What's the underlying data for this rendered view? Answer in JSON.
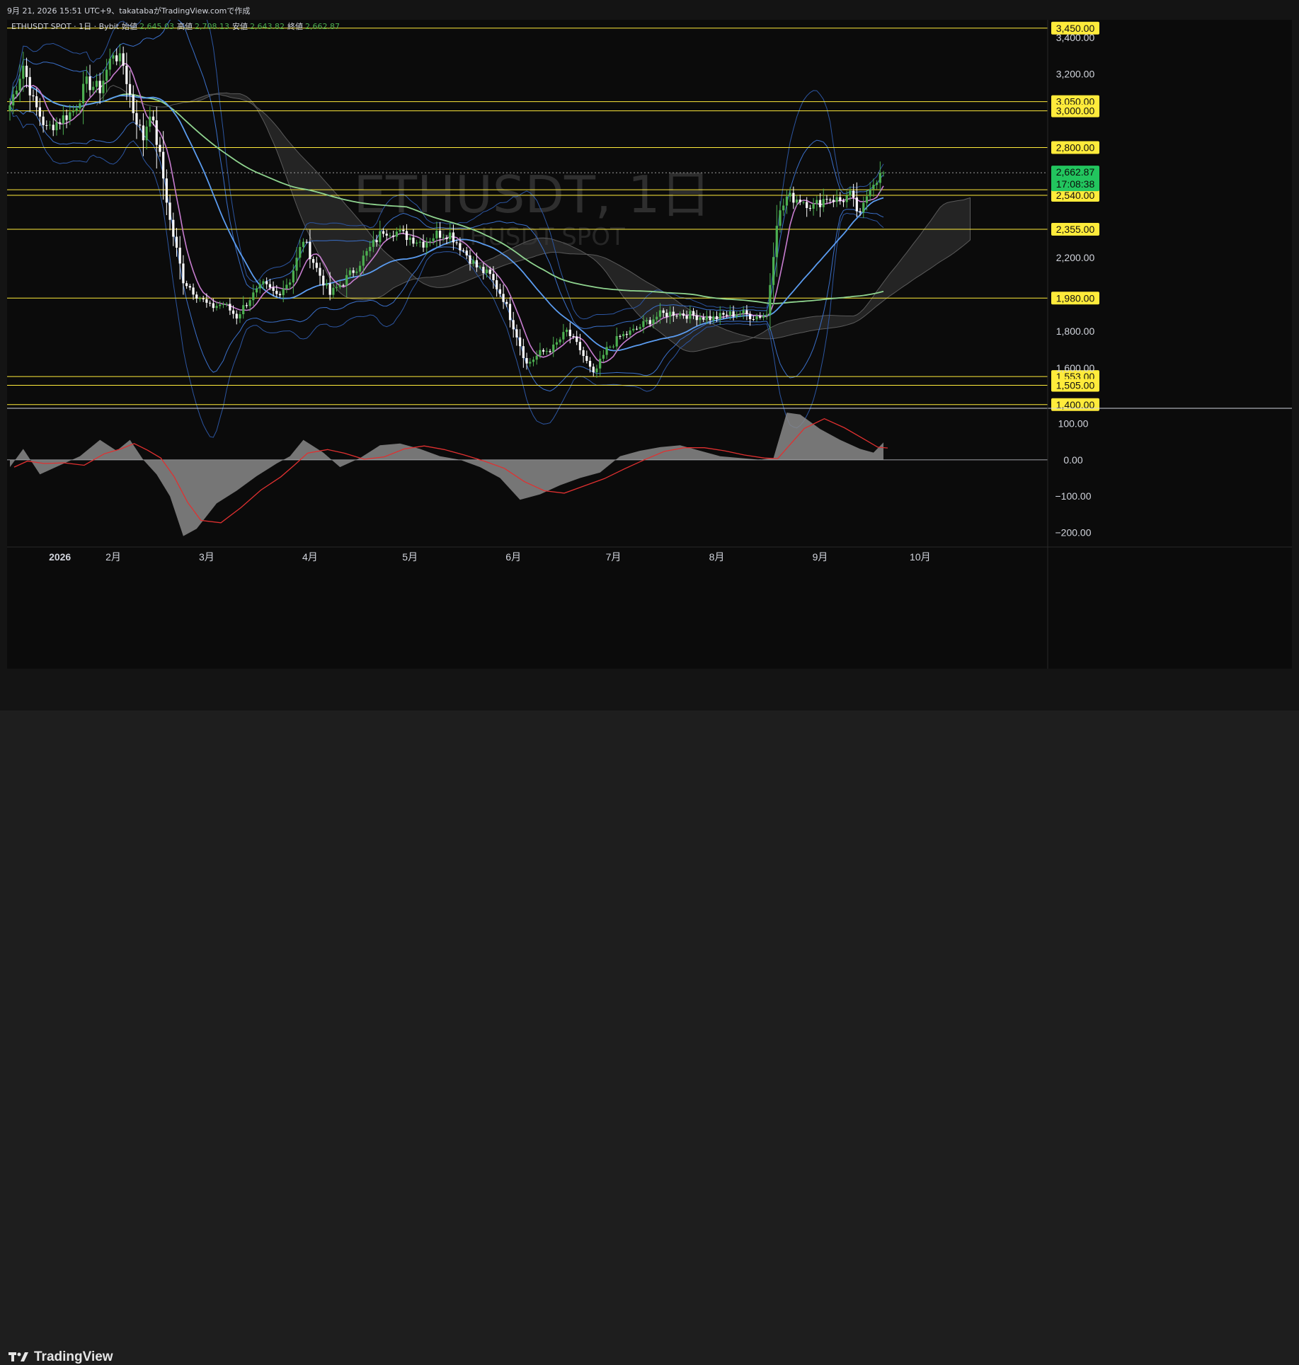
{
  "header": {
    "capture_info": "9月 21, 2026 15:51 UTC+9、takatabaがTradingView.comで作成"
  },
  "legend": {
    "symbol": "ETHUSDT SPOT · 1日 · Bybit",
    "open_label": "始値",
    "open_value": "2,645.03",
    "high_label": "高値",
    "high_value": "2,708.13",
    "low_label": "安値",
    "low_value": "2,643.82",
    "close_label": "終値",
    "close_value": "2,662.87"
  },
  "watermark": {
    "line1": "ETHUSDT, 1日",
    "line2": "ETHUSDT SPOT"
  },
  "footer": {
    "brand": "TradingView"
  },
  "colors": {
    "background": "#0b0b0b",
    "up_candle": "#4caf50",
    "down_candle": "#ffffff",
    "horizontal_line": "#ffeb3b",
    "current_price_bg": "#22c55e",
    "ma_fast": "#c77dcf",
    "ma_mid": "#5b9cf0",
    "ma_slow": "#8fd48f",
    "bollinger": "#3a6fc9",
    "cloud": "#3a3a3a",
    "oscillator_fill": "#8a8a8a",
    "signal_line": "#e03030"
  },
  "chart_data": {
    "type": "candlestick",
    "timeframe": "1日",
    "exchange": "Bybit",
    "symbol": "ETHUSDT",
    "ylim": [
      1380,
      3480
    ],
    "y_axis_ticks": [
      1600,
      1800,
      2200,
      3200,
      3400
    ],
    "y_axis_tick_labels": [
      "1,600.00",
      "1,800.00",
      "2,200.00",
      "3,200.00",
      "3,400.00"
    ],
    "x_axis_labels": [
      "2026",
      "2月",
      "3月",
      "4月",
      "5月",
      "6月",
      "7月",
      "8月",
      "9月",
      "10月"
    ],
    "horizontal_levels": [
      3450,
      3050,
      3000,
      2800,
      2570,
      2540,
      2355,
      1980,
      1553,
      1505,
      1400
    ],
    "horizontal_level_labels": [
      "3,450.00",
      "3,050.00",
      "3,000.00",
      "2,800.00",
      "2,570.00",
      "2,540.00",
      "2,355.00",
      "1,980.00",
      "1,553.00",
      "1,505.00",
      "1,400.00"
    ],
    "current_price": 2662.87,
    "current_price_label": "2,662.87",
    "countdown": "17:08:38",
    "close_path": [
      [
        "2026-01-01",
        3030
      ],
      [
        "2026-01-05",
        3250
      ],
      [
        "2026-01-08",
        3050
      ],
      [
        "2026-01-12",
        2900
      ],
      [
        "2026-01-16",
        2950
      ],
      [
        "2026-01-20",
        3000
      ],
      [
        "2026-01-24",
        3150
      ],
      [
        "2026-01-28",
        3120
      ],
      [
        "2026-02-01",
        3320
      ],
      [
        "2026-02-04",
        3250
      ],
      [
        "2026-02-07",
        3000
      ],
      [
        "2026-02-10",
        2850
      ],
      [
        "2026-02-12",
        3000
      ],
      [
        "2026-02-15",
        2750
      ],
      [
        "2026-02-18",
        2400
      ],
      [
        "2026-02-22",
        2080
      ],
      [
        "2026-02-26",
        2000
      ],
      [
        "2026-03-02",
        1930
      ],
      [
        "2026-03-06",
        1950
      ],
      [
        "2026-03-10",
        1880
      ],
      [
        "2026-03-14",
        1980
      ],
      [
        "2026-03-18",
        2050
      ],
      [
        "2026-03-22",
        2000
      ],
      [
        "2026-03-26",
        2080
      ],
      [
        "2026-03-30",
        2300
      ],
      [
        "2026-04-03",
        2140
      ],
      [
        "2026-04-07",
        2000
      ],
      [
        "2026-04-11",
        2070
      ],
      [
        "2026-04-15",
        2150
      ],
      [
        "2026-04-19",
        2250
      ],
      [
        "2026-04-23",
        2350
      ],
      [
        "2026-04-27",
        2340
      ],
      [
        "2026-05-01",
        2310
      ],
      [
        "2026-05-05",
        2280
      ],
      [
        "2026-05-09",
        2330
      ],
      [
        "2026-05-13",
        2330
      ],
      [
        "2026-05-17",
        2240
      ],
      [
        "2026-05-21",
        2150
      ],
      [
        "2026-05-25",
        2100
      ],
      [
        "2026-05-29",
        1980
      ],
      [
        "2026-06-02",
        1780
      ],
      [
        "2026-06-05",
        1620
      ],
      [
        "2026-06-09",
        1680
      ],
      [
        "2026-06-13",
        1710
      ],
      [
        "2026-06-17",
        1800
      ],
      [
        "2026-06-21",
        1700
      ],
      [
        "2026-06-25",
        1560
      ],
      [
        "2026-06-29",
        1700
      ],
      [
        "2026-07-03",
        1770
      ],
      [
        "2026-07-07",
        1800
      ],
      [
        "2026-07-11",
        1850
      ],
      [
        "2026-07-15",
        1890
      ],
      [
        "2026-07-19",
        1900
      ],
      [
        "2026-07-23",
        1890
      ],
      [
        "2026-07-27",
        1880
      ],
      [
        "2026-07-31",
        1870
      ],
      [
        "2026-08-04",
        1890
      ],
      [
        "2026-08-08",
        1900
      ],
      [
        "2026-08-12",
        1880
      ],
      [
        "2026-08-16",
        1890
      ],
      [
        "2026-08-19",
        2400
      ],
      [
        "2026-08-22",
        2530
      ],
      [
        "2026-08-26",
        2520
      ],
      [
        "2026-08-30",
        2480
      ],
      [
        "2026-09-03",
        2530
      ],
      [
        "2026-09-07",
        2510
      ],
      [
        "2026-09-10",
        2540
      ],
      [
        "2026-09-13",
        2420
      ],
      [
        "2026-09-16",
        2600
      ],
      [
        "2026-09-20",
        2662.87
      ]
    ],
    "oscillator": {
      "y_axis_ticks": [
        100,
        0,
        -100,
        -200
      ],
      "y_axis_tick_labels": [
        "100.00",
        "0.00",
        "−100.00",
        "−200.00"
      ],
      "ylim": [
        -240,
        140
      ],
      "values": [
        [
          "2026-01-01",
          -20
        ],
        [
          "2026-01-05",
          30
        ],
        [
          "2026-01-10",
          -40
        ],
        [
          "2026-01-16",
          -15
        ],
        [
          "2026-01-22",
          10
        ],
        [
          "2026-01-28",
          55
        ],
        [
          "2026-02-02",
          25
        ],
        [
          "2026-02-06",
          55
        ],
        [
          "2026-02-10",
          0
        ],
        [
          "2026-02-14",
          -40
        ],
        [
          "2026-02-18",
          -100
        ],
        [
          "2026-02-22",
          -210
        ],
        [
          "2026-02-26",
          -190
        ],
        [
          "2026-03-04",
          -120
        ],
        [
          "2026-03-10",
          -85
        ],
        [
          "2026-03-16",
          -45
        ],
        [
          "2026-03-22",
          -10
        ],
        [
          "2026-03-26",
          10
        ],
        [
          "2026-03-30",
          55
        ],
        [
          "2026-04-05",
          20
        ],
        [
          "2026-04-10",
          -20
        ],
        [
          "2026-04-16",
          5
        ],
        [
          "2026-04-22",
          40
        ],
        [
          "2026-04-28",
          45
        ],
        [
          "2026-05-04",
          30
        ],
        [
          "2026-05-10",
          10
        ],
        [
          "2026-05-16",
          0
        ],
        [
          "2026-05-22",
          -20
        ],
        [
          "2026-05-28",
          -50
        ],
        [
          "2026-06-03",
          -110
        ],
        [
          "2026-06-09",
          -95
        ],
        [
          "2026-06-15",
          -70
        ],
        [
          "2026-06-21",
          -50
        ],
        [
          "2026-06-27",
          -35
        ],
        [
          "2026-07-03",
          10
        ],
        [
          "2026-07-09",
          25
        ],
        [
          "2026-07-15",
          35
        ],
        [
          "2026-07-21",
          40
        ],
        [
          "2026-07-27",
          25
        ],
        [
          "2026-08-02",
          10
        ],
        [
          "2026-08-08",
          5
        ],
        [
          "2026-08-14",
          0
        ],
        [
          "2026-08-18",
          5
        ],
        [
          "2026-08-22",
          130
        ],
        [
          "2026-08-26",
          125
        ],
        [
          "2026-09-01",
          85
        ],
        [
          "2026-09-07",
          55
        ],
        [
          "2026-09-13",
          30
        ],
        [
          "2026-09-17",
          20
        ],
        [
          "2026-09-20",
          48
        ]
      ]
    }
  }
}
